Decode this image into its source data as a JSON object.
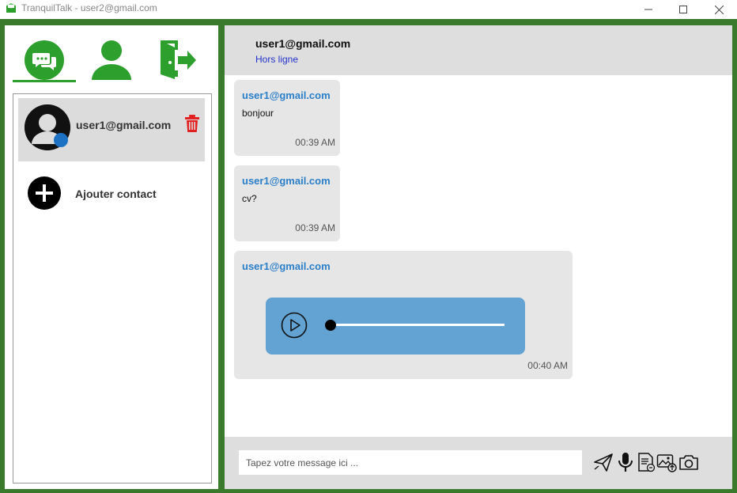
{
  "window": {
    "title": "TranquilTalk - user2@gmail.com"
  },
  "nav": {
    "items": [
      {
        "name": "chats",
        "icon": "chat-bubbles-icon"
      },
      {
        "name": "profile",
        "icon": "user-icon"
      },
      {
        "name": "logout",
        "icon": "exit-door-icon"
      }
    ],
    "active": "chats"
  },
  "contacts": [
    {
      "name": "user1@gmail.com",
      "status_color": "#1d72c4"
    }
  ],
  "add_contact": {
    "label": "Ajouter contact"
  },
  "chat": {
    "peer_name": "user1@gmail.com",
    "peer_status": "Hors ligne",
    "messages": [
      {
        "sender": "user1@gmail.com",
        "text": "bonjour",
        "time": "00:39 AM"
      },
      {
        "sender": "user1@gmail.com",
        "text": "cv?",
        "time": "00:39 AM"
      },
      {
        "sender": "user1@gmail.com",
        "type": "audio",
        "time": "00:40 AM",
        "audio_progress": 0.0
      }
    ]
  },
  "composer": {
    "placeholder": "Tapez votre message ici ...",
    "value": "",
    "tools": [
      "send-icon",
      "microphone-icon",
      "document-icon",
      "image-upload-icon",
      "camera-icon"
    ]
  },
  "colors": {
    "frame": "#3a7a2c",
    "accent_green": "#2d9f2d",
    "sender_blue": "#2a7fc8",
    "audio_bg": "#62a3d3",
    "delete_red": "#e32020"
  }
}
